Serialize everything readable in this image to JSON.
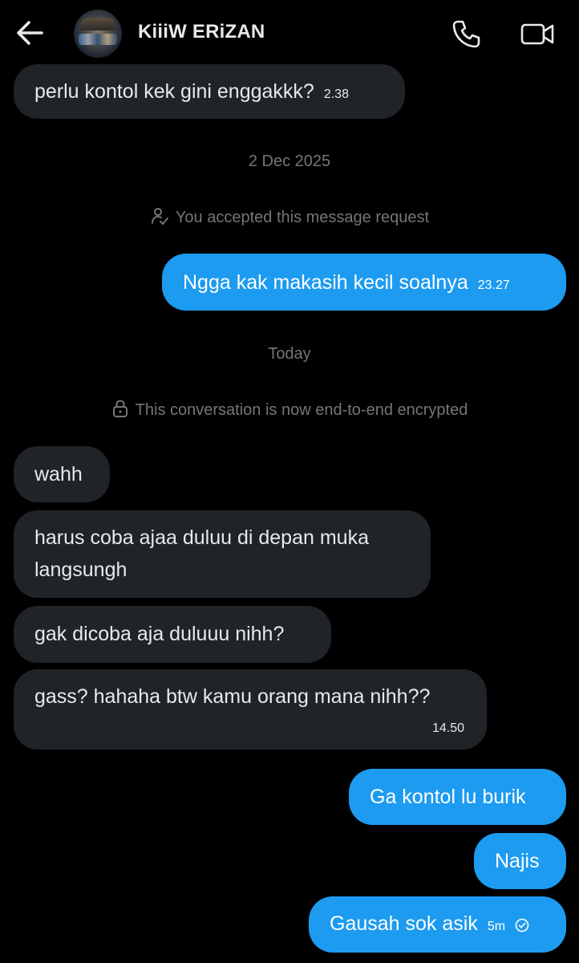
{
  "header": {
    "contact_name": "KiiiW ERiZAN",
    "back_icon": "arrow-left-icon",
    "call_icon": "phone-icon",
    "video_icon": "video-camera-icon"
  },
  "colors": {
    "background": "#000000",
    "incoming_bubble": "#202327",
    "outgoing_bubble": "#1d9bf0",
    "system_text": "#71767b"
  },
  "messages": {
    "m1": {
      "text": "perlu kontol kek gini enggakkk?",
      "time": "2.38",
      "direction": "incoming"
    },
    "date1": "2 Dec 2025",
    "request_notice": {
      "icon": "person-check-icon",
      "text": "You accepted this message request"
    },
    "m2": {
      "text": "Ngga kak makasih kecil soalnya",
      "time": "23.27",
      "direction": "outgoing"
    },
    "date2": "Today",
    "encryption_notice": {
      "icon": "lock-icon",
      "text": "This conversation is now end-to-end encrypted"
    },
    "m3": {
      "text": "wahh",
      "direction": "incoming"
    },
    "m4": {
      "text": "harus coba ajaa duluu di depan muka langsungh",
      "direction": "incoming"
    },
    "m5": {
      "text": "gak dicoba aja duluuu nihh?",
      "direction": "incoming"
    },
    "m6": {
      "text": "gass? hahaha btw kamu orang mana nihh??",
      "time": "14.50",
      "direction": "incoming"
    },
    "m7": {
      "text": "Ga kontol lu burik",
      "direction": "outgoing"
    },
    "m8": {
      "text": "Najis",
      "direction": "outgoing"
    },
    "m9": {
      "text": "Gausah sok asik",
      "time": "5m",
      "status_icon": "check-circle-icon",
      "direction": "outgoing"
    }
  }
}
